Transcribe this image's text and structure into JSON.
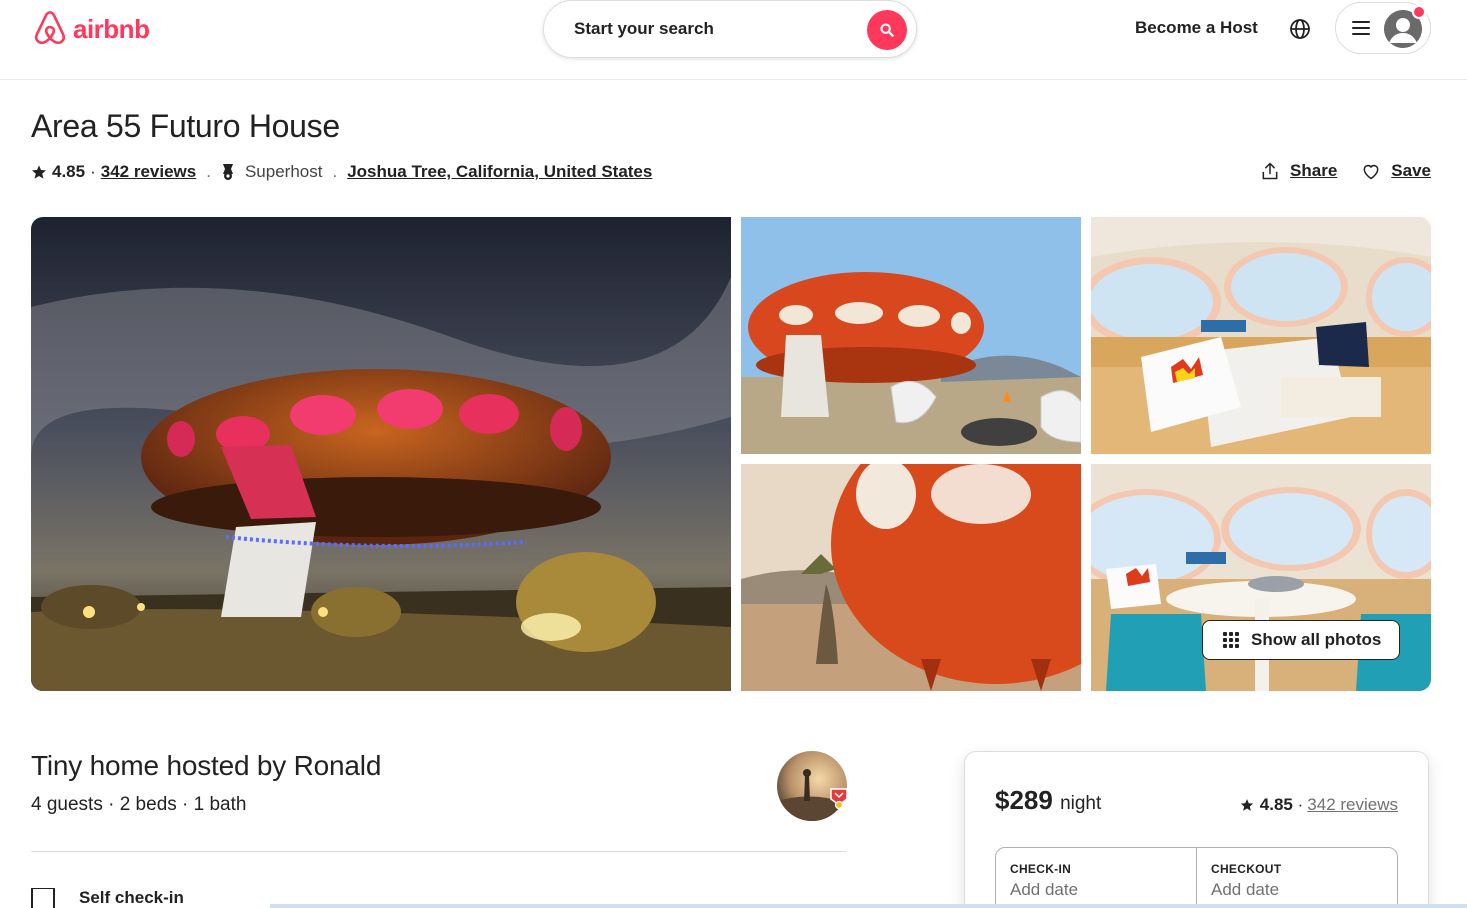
{
  "header": {
    "logo_text": "airbnb",
    "search_label": "Start your search",
    "become_host": "Become a Host"
  },
  "listing": {
    "title": "Area 55 Futuro House",
    "rating": "4.85",
    "reviews": "342 reviews",
    "superhost": "Superhost",
    "location": "Joshua Tree, California, United States",
    "share": "Share",
    "save": "Save"
  },
  "gallery": {
    "show_all": "Show all photos"
  },
  "host": {
    "title": "Tiny home hosted by Ronald",
    "specs": "4 guests · 2 beds · 1 bath",
    "self_checkin": "Self check-in"
  },
  "booking": {
    "price": "$289",
    "price_unit": "night",
    "rating": "4.85",
    "reviews": "342 reviews",
    "checkin_label": "CHECK-IN",
    "checkin_value": "Add date",
    "checkout_label": "CHECKOUT",
    "checkout_value": "Add date"
  },
  "colors": {
    "brand": "#ff385c",
    "text": "#222222",
    "muted": "#717171"
  },
  "icons": [
    "airbnb-logo-icon",
    "search-icon",
    "globe-icon",
    "menu-icon",
    "user-avatar-icon",
    "star-icon",
    "superhost-badge-icon",
    "share-icon",
    "heart-icon",
    "grid-icon",
    "door-icon"
  ]
}
